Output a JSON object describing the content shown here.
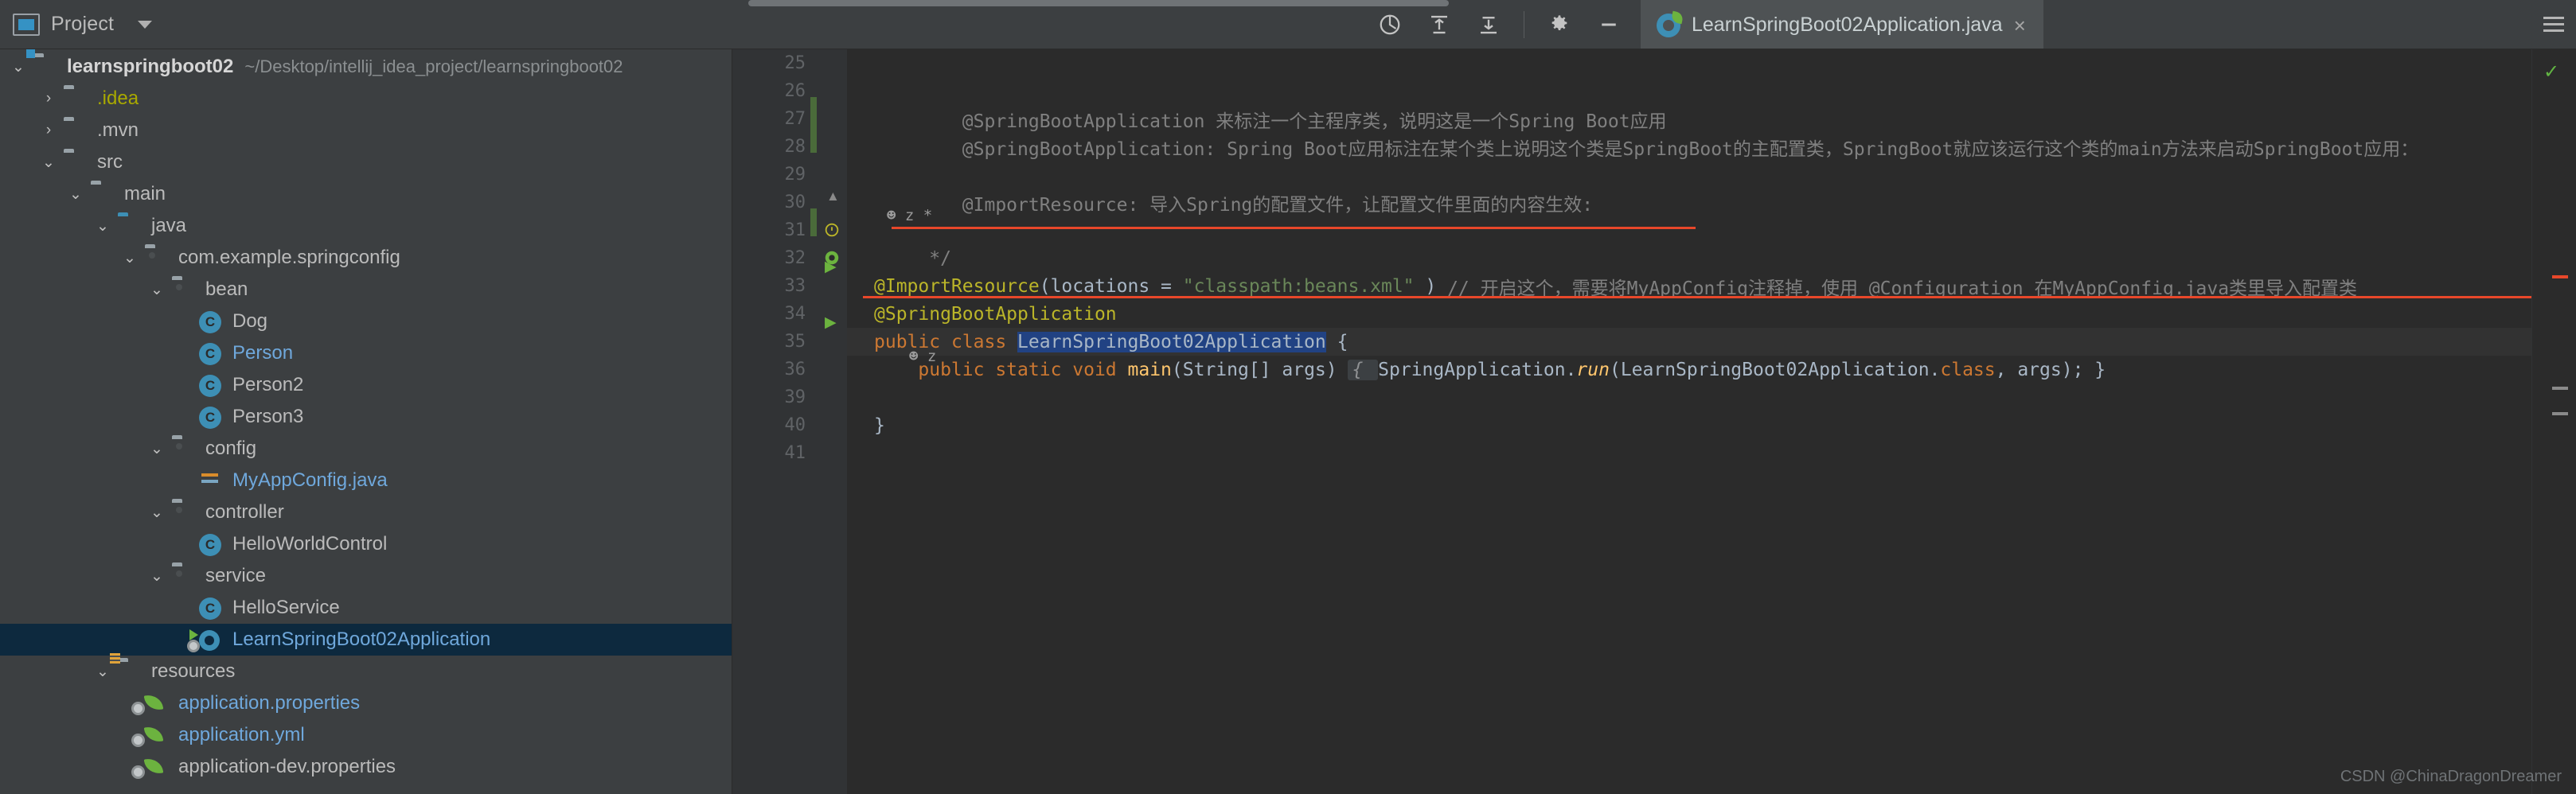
{
  "window": {
    "panel_title": "Project",
    "panel_dropdown_icon": "chevron-down-icon"
  },
  "toolbar": {
    "icons": [
      {
        "name": "locate-icon",
        "glyph": "⊕"
      },
      {
        "name": "expand-all-icon",
        "glyph": "⤓"
      },
      {
        "name": "collapse-all-icon",
        "glyph": "⤓"
      },
      {
        "name": "settings-gear-icon",
        "glyph": "⚙"
      },
      {
        "name": "hide-panel-icon",
        "glyph": "—"
      }
    ],
    "menu_icon": "hamburger-menu-icon"
  },
  "editor_tab": {
    "label": "LearnSpringBoot02Application.java",
    "icon": "spring-boot-class-icon",
    "close_label": "×"
  },
  "tree": {
    "root": {
      "label": "learnspringboot02",
      "path": "~/Desktop/intellij_idea_project/learnspringboot02"
    },
    "items": [
      {
        "label": ".idea",
        "indent": 1,
        "arrow": "right",
        "icon": "folder",
        "style": "yellow"
      },
      {
        "label": ".mvn",
        "indent": 1,
        "arrow": "right",
        "icon": "folder",
        "style": "plain"
      },
      {
        "label": "src",
        "indent": 1,
        "arrow": "down",
        "icon": "folder",
        "style": "plain"
      },
      {
        "label": "main",
        "indent": 2,
        "arrow": "down",
        "icon": "folder",
        "style": "plain"
      },
      {
        "label": "java",
        "indent": 3,
        "arrow": "down",
        "icon": "folder-source",
        "style": "plain"
      },
      {
        "label": "com.example.springconfig",
        "indent": 4,
        "arrow": "down",
        "icon": "folder-package",
        "style": "plain"
      },
      {
        "label": "bean",
        "indent": 5,
        "arrow": "down",
        "icon": "folder-package",
        "style": "plain"
      },
      {
        "label": "Dog",
        "indent": 6,
        "arrow": "none",
        "icon": "java-class",
        "style": "plain"
      },
      {
        "label": "Person",
        "indent": 6,
        "arrow": "none",
        "icon": "java-class",
        "style": "blue"
      },
      {
        "label": "Person2",
        "indent": 6,
        "arrow": "none",
        "icon": "java-class",
        "style": "plain"
      },
      {
        "label": "Person3",
        "indent": 6,
        "arrow": "none",
        "icon": "java-class",
        "style": "plain"
      },
      {
        "label": "config",
        "indent": 5,
        "arrow": "down",
        "icon": "folder-package",
        "style": "plain"
      },
      {
        "label": "MyAppConfig.java",
        "indent": 6,
        "arrow": "none",
        "icon": "config-class",
        "style": "blue"
      },
      {
        "label": "controller",
        "indent": 5,
        "arrow": "down",
        "icon": "folder-package",
        "style": "plain"
      },
      {
        "label": "HelloWorldControl",
        "indent": 6,
        "arrow": "none",
        "icon": "java-class",
        "style": "plain"
      },
      {
        "label": "service",
        "indent": 5,
        "arrow": "down",
        "icon": "folder-package",
        "style": "plain"
      },
      {
        "label": "HelloService",
        "indent": 6,
        "arrow": "none",
        "icon": "java-class",
        "style": "plain"
      },
      {
        "label": "LearnSpringBoot02Application",
        "indent": 6,
        "arrow": "none",
        "icon": "spring-run-class",
        "style": "selected"
      },
      {
        "label": "resources",
        "indent": 3,
        "arrow": "down",
        "icon": "folder-resources",
        "style": "plain"
      },
      {
        "label": "application.properties",
        "indent": 4,
        "arrow": "none",
        "icon": "spring-config",
        "style": "blue"
      },
      {
        "label": "application.yml",
        "indent": 4,
        "arrow": "none",
        "icon": "spring-config",
        "style": "blue"
      },
      {
        "label": "application-dev.properties",
        "indent": 4,
        "arrow": "none",
        "icon": "spring-config",
        "style": "plain"
      }
    ]
  },
  "code": {
    "line_numbers": [
      "25",
      "26",
      "27",
      "28",
      "29",
      "30",
      "31",
      "32",
      "",
      "33",
      "34",
      "35",
      "",
      "36",
      "39",
      "40",
      "41"
    ],
    "lines": [
      {
        "num": "25",
        "segments": []
      },
      {
        "num": "26",
        "segments": []
      },
      {
        "num": "27",
        "segments": [
          {
            "t": "        @SpringBootApplication 来标注一个主程序类，说明这是一个Spring Boot应用",
            "c": "cmt"
          }
        ]
      },
      {
        "num": "28",
        "segments": [
          {
            "t": "        @SpringBootApplication: Spring Boot应用标注在某个类上说明这个类是SpringBoot的主配置类，SpringBoot就应该运行这个类的main方法来启动SpringBoot应用：",
            "c": "cmt"
          }
        ]
      },
      {
        "num": "29",
        "segments": []
      },
      {
        "num": "30",
        "segments": [
          {
            "t": "        @ImportResource: 导入Spring的配置文件，让配置文件里面的内容生效:",
            "c": "cmt"
          }
        ]
      },
      {
        "num": "31",
        "segments": []
      },
      {
        "num": "32",
        "segments": [
          {
            "t": "     */",
            "c": "cmt"
          }
        ]
      },
      {
        "num": "33",
        "segments": [
          {
            "t": "@ImportResource",
            "c": "ann"
          },
          {
            "t": "(locations = ",
            "c": "plain"
          },
          {
            "t": "\"classpath:beans.xml\"",
            "c": "str"
          },
          {
            "t": " ) ",
            "c": "plain"
          },
          {
            "t": "// 开启这个，需要将MyAppConfig注释掉，使用 @Configuration 在MyAppConfig.java类里导入配置类",
            "c": "cmt"
          }
        ]
      },
      {
        "num": "34",
        "segments": [
          {
            "t": "@SpringBootApplication",
            "c": "ann"
          }
        ]
      },
      {
        "num": "35",
        "segments": [
          {
            "t": "public ",
            "c": "kw"
          },
          {
            "t": "class ",
            "c": "kw"
          },
          {
            "t": "LearnSpringBoot02Application",
            "c": "sel"
          },
          {
            "t": " {",
            "c": "plain"
          }
        ]
      },
      {
        "num": "36",
        "segments": [
          {
            "t": "    public ",
            "c": "kw"
          },
          {
            "t": "static ",
            "c": "kw"
          },
          {
            "t": "void ",
            "c": "kw"
          },
          {
            "t": "main",
            "c": "fieldw"
          },
          {
            "t": "(String[] args) ",
            "c": "plain"
          },
          {
            "t": "{ ",
            "c": "hint"
          },
          {
            "t": "SpringApplication.",
            "c": "plain"
          },
          {
            "t": "run",
            "c": "italic"
          },
          {
            "t": "(LearnSpringBoot02Application.",
            "c": "plain"
          },
          {
            "t": "class",
            "c": "kw"
          },
          {
            "t": ", args); }",
            "c": "plain"
          }
        ]
      },
      {
        "num": "39",
        "segments": []
      },
      {
        "num": "40",
        "segments": [
          {
            "t": "}",
            "c": "plain"
          }
        ]
      },
      {
        "num": "41",
        "segments": []
      }
    ],
    "inlay_hints": [
      "⚥ z *",
      "⚥ z"
    ]
  },
  "status": {
    "watermark": "CSDN @ChinaDragonDreamer",
    "inspection_icon": "check-ok-icon"
  },
  "colors": {
    "background": "#3c3f41",
    "editor_bg": "#2b2b2b",
    "accent_blue": "#3d8fb5",
    "selection": "#0d293e",
    "error_red": "#e8472a",
    "annotation_yellow": "#bbb529",
    "string_green": "#6a8759",
    "keyword_orange": "#cc7832",
    "spring_green": "#6cb33f"
  }
}
